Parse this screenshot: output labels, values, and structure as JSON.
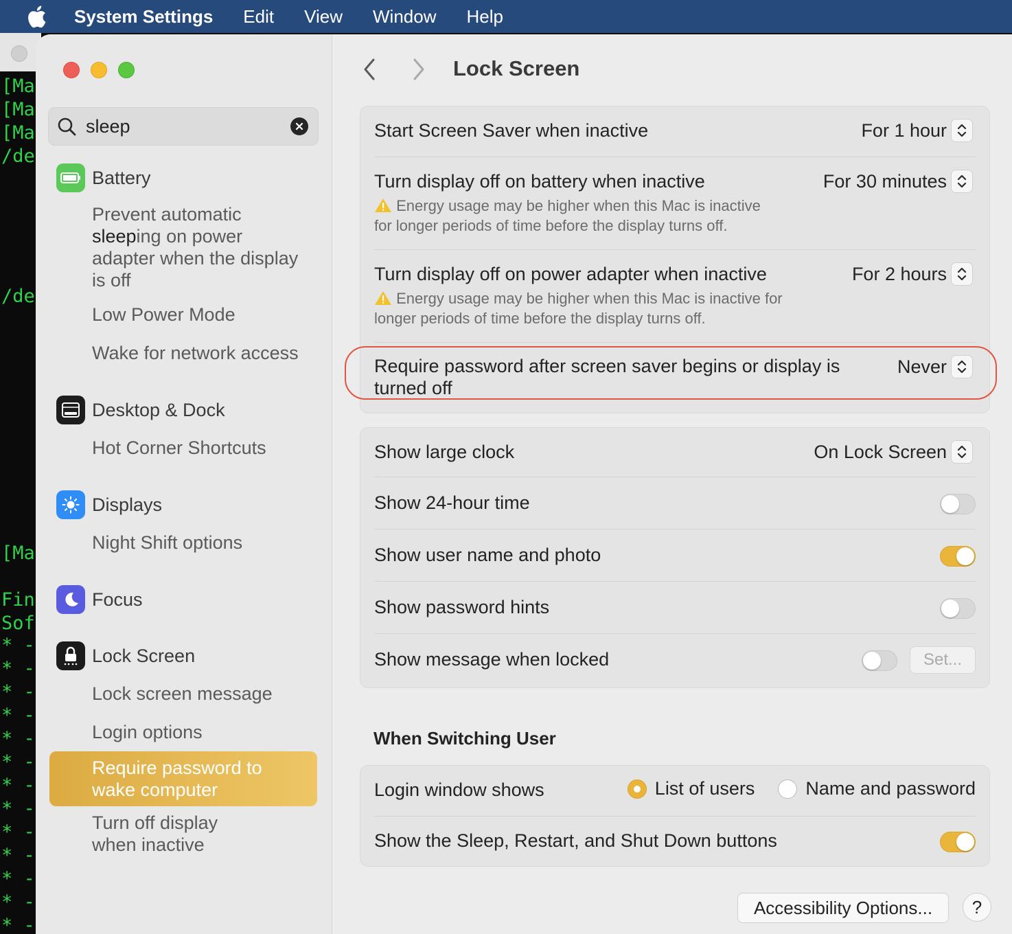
{
  "menubar": {
    "app": "System Settings",
    "items": [
      "Edit",
      "View",
      "Window",
      "Help"
    ]
  },
  "terminal": {
    "lines": [
      "[Mac",
      "[Mac",
      "[Mac",
      "/de",
      "/de",
      "[Mac",
      "Fin",
      "Sof",
      "* -",
      "* -",
      "* -",
      "* -",
      "* -",
      "* -",
      "* -",
      "* -",
      "* -",
      "* -",
      "* -",
      "* -",
      "* -"
    ]
  },
  "search": {
    "value": "sleep"
  },
  "sidebar": {
    "battery": {
      "label": "Battery",
      "sub1_a": "Prevent automatic",
      "sub1_b_bold": "sleep",
      "sub1_b_rest": "ing on power",
      "sub1_c": "adapter when the display",
      "sub1_d": "is off",
      "sub2": "Low Power Mode",
      "sub3": "Wake for network access"
    },
    "desktop": {
      "label": "Desktop & Dock",
      "sub1": "Hot Corner Shortcuts"
    },
    "displays": {
      "label": "Displays",
      "sub1": "Night Shift options"
    },
    "focus": {
      "label": "Focus"
    },
    "lockscreen": {
      "label": "Lock Screen",
      "sub1": "Lock screen message",
      "sub2": "Login options",
      "sub3_a": "Require password to",
      "sub3_b": "wake computer",
      "sub4_a": "Turn off display",
      "sub4_b": "when inactive"
    }
  },
  "main": {
    "title": "Lock Screen",
    "group1": {
      "screensaver": {
        "label": "Start Screen Saver when inactive",
        "value": "For 1 hour"
      },
      "battery": {
        "label": "Turn display off on battery when inactive",
        "value": "For 30 minutes",
        "note_a": "Energy usage may be higher when this Mac is inactive",
        "note_b": "for longer periods of time before the display turns off."
      },
      "adapter": {
        "label": "Turn display off on power adapter when inactive",
        "value": "For 2 hours",
        "note_a": "Energy usage may be higher when this Mac is inactive for",
        "note_b": "longer periods of time before the display turns off."
      },
      "password": {
        "label_a": "Require password after screen saver begins or display is",
        "label_b": "turned off",
        "value": "Never"
      }
    },
    "group2": {
      "clock": {
        "label": "Show large clock",
        "value": "On Lock Screen"
      },
      "time24": {
        "label": "Show 24-hour time",
        "on": false
      },
      "username": {
        "label": "Show user name and photo",
        "on": true
      },
      "hints": {
        "label": "Show password hints",
        "on": false
      },
      "message": {
        "label": "Show message when locked",
        "on": false,
        "button": "Set..."
      }
    },
    "switching": {
      "title": "When Switching User",
      "login_label": "Login window shows",
      "option1": "List of users",
      "option2": "Name and password",
      "selected": "List of users",
      "buttons_label": "Show the Sleep, Restart, and Shut Down buttons",
      "buttons_on": true
    },
    "accessibility_button": "Accessibility Options...",
    "help_button": "?"
  },
  "colors": {
    "menubar": "#274a7c",
    "accent": "#e9b53a",
    "highlight_ring": "#e0553e",
    "terminal_text": "#2fd24a"
  }
}
